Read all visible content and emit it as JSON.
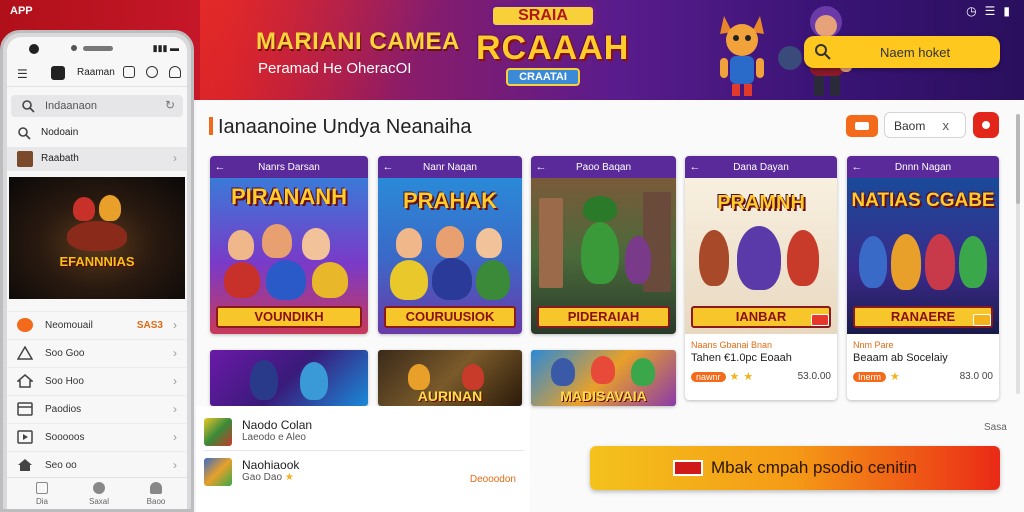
{
  "app_tag": "APP",
  "banner": {
    "title": "MARIANI CAMEA",
    "subtitle": "Peramad He OheracOI",
    "logo_top": "SRAIA",
    "logo_main": "RCAAAH",
    "logo_bottom": "CRAATAI",
    "search_text": "Naem hoket"
  },
  "section": {
    "title": "Ianaanoine Undya Neanaiha",
    "filter_text": "Baom",
    "filter_close": "x"
  },
  "cards": [
    {
      "header": "Nanrs Darsan",
      "art_title": "PIRANANH",
      "caption": "VOUNDIKH"
    },
    {
      "header": "Nanr Naqan",
      "art_title": "PRAHAK",
      "caption": "COURUUSIOK"
    },
    {
      "header": "Paoo Baqan",
      "art_title": "",
      "caption": "PIDERAIAH"
    },
    {
      "header": "Dana Dayan",
      "art_title": "PRAMNH",
      "caption": "IANBAR",
      "label": "Naans Gbanai Bnan",
      "line2": "Tahen €1.0pc Eoaah",
      "tag": "nawnr",
      "price": "53.0.00"
    },
    {
      "header": "Dnnn Nagan",
      "art_title": "NATIAS CGABE",
      "caption": "RANAERE",
      "label": "Nnm Pare",
      "line2": "Beaam ab Socelaiy",
      "tag": "Inerm",
      "price": "83.0 00"
    }
  ],
  "thumbs": [
    {
      "text": ""
    },
    {
      "text": "AURINAN"
    },
    {
      "text": "MADISAVAIA"
    }
  ],
  "bottom_list": [
    {
      "title": "Naodo Colan",
      "sub": "Laeodo e Aleo",
      "right": ""
    },
    {
      "title": "Naohiaook",
      "sub": "Gao Dao",
      "right": "Deooodon"
    }
  ],
  "bottom_right_label": "Sasa",
  "cta": {
    "text": "Mbak cmpah psodio cenitin"
  },
  "phone": {
    "signal": "▮▮▮ ▬",
    "app_title": "Raaman",
    "search_text": "Indaanaon",
    "rows": [
      {
        "text": "Nodoain"
      },
      {
        "text": "Raabath"
      }
    ],
    "hero_text": "EFANNNIAS",
    "list": [
      {
        "text": "Neomouail",
        "val": "SAS3"
      },
      {
        "text": "Soo Goo",
        "val": ""
      },
      {
        "text": "Soo Hoo",
        "val": ""
      },
      {
        "text": "Paodios",
        "val": ""
      },
      {
        "text": "Sooooos",
        "val": ""
      },
      {
        "text": "Seo oo",
        "val": ""
      }
    ],
    "nav": [
      "Dia",
      "Saxal",
      "Baoo"
    ]
  },
  "colors": {
    "accent_orange": "#f26a1a",
    "card_header": "#5a2a9a",
    "banner_search": "#ffc81f",
    "cta_start": "#f3c21c",
    "cta_end": "#ea2a16"
  }
}
